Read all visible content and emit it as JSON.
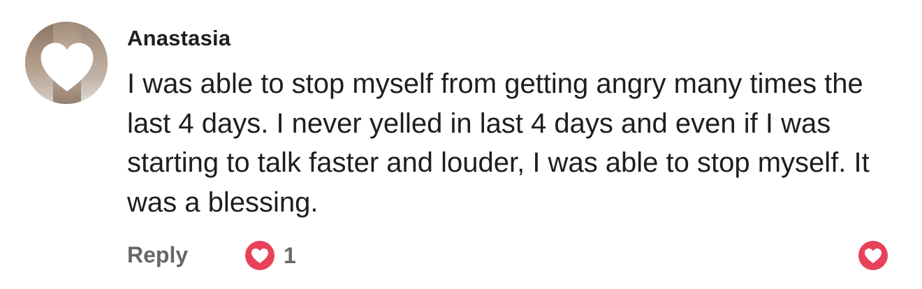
{
  "comment": {
    "author": "Anastasia",
    "text": "I was able to stop myself from getting angry many times the last 4 days. I never yelled in last 4 days and even if I was starting to talk faster and louder, I was able to stop myself. It was a blessing.",
    "avatar_icon": "heart-mask-icon"
  },
  "actions": {
    "reply_label": "Reply",
    "reaction_count": "1",
    "reaction_icon": "love-reaction-icon",
    "like_icon": "heart-like-icon"
  },
  "colors": {
    "reaction_red": "#e8425a",
    "muted_text": "#65676b",
    "text": "#1c1e21"
  }
}
